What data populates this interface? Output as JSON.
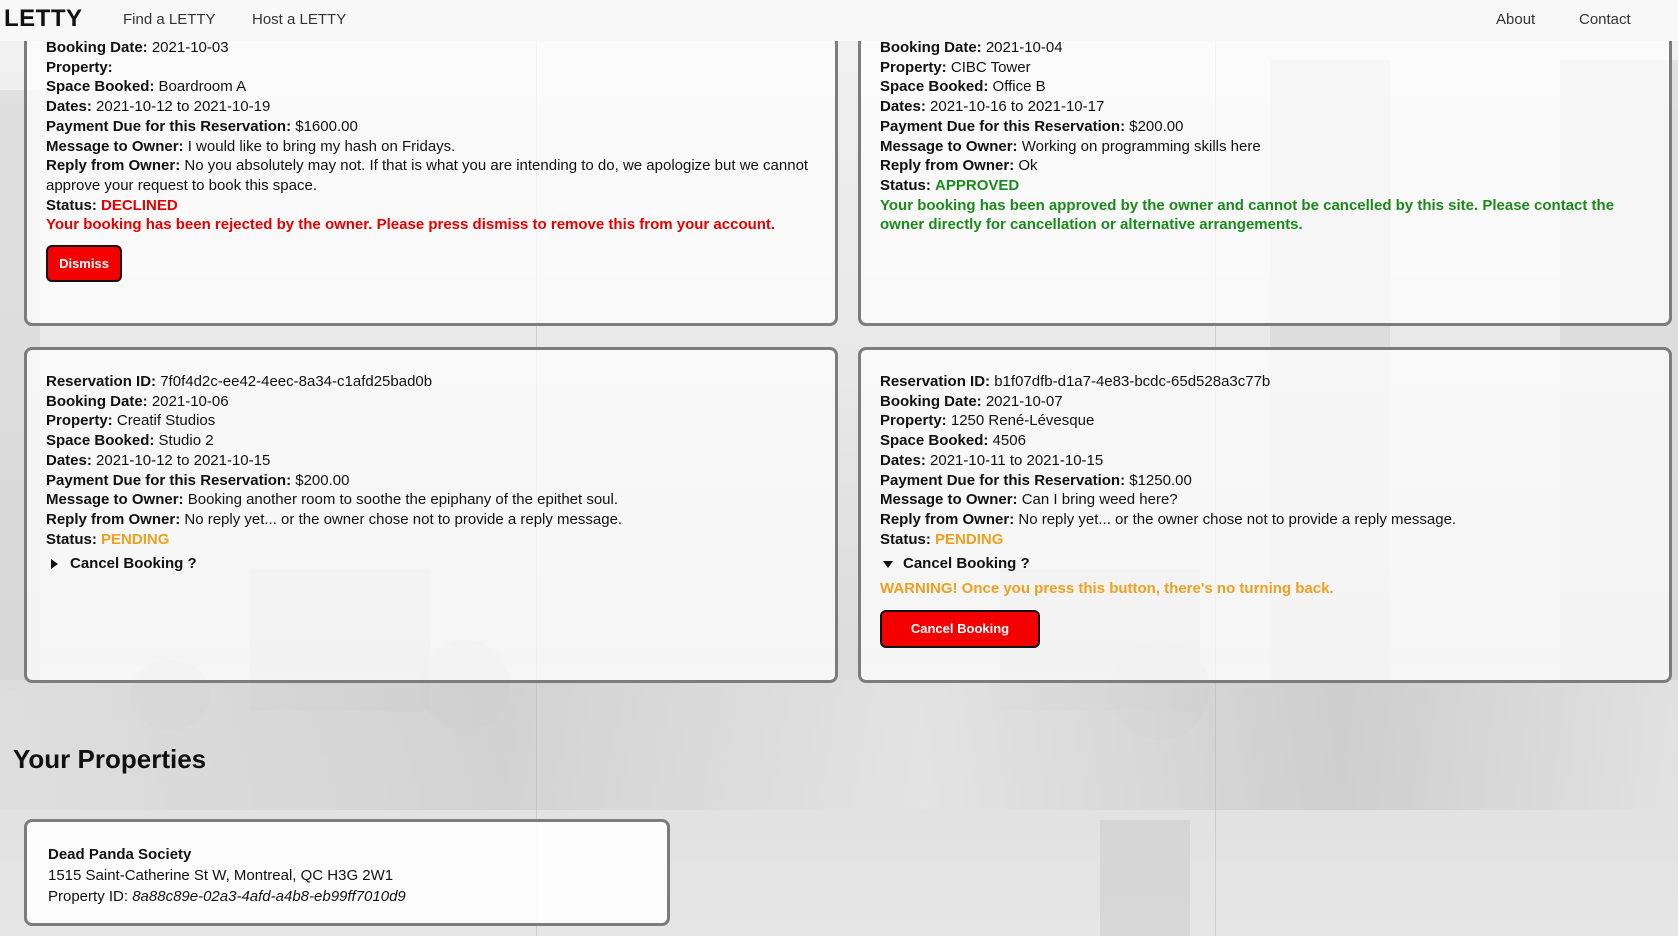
{
  "nav": {
    "brand": "LETTY",
    "links": [
      "Find a LETTY",
      "Host a LETTY"
    ],
    "right_links": [
      "About",
      "Contact"
    ]
  },
  "labels": {
    "reservation_id": "Reservation ID:",
    "booking_date": "Booking Date:",
    "property": "Property:",
    "space_booked": "Space Booked:",
    "dates": "Dates:",
    "payment": "Payment Due for this Reservation:",
    "message": "Message to Owner:",
    "reply": "Reply from Owner:",
    "status": "Status:"
  },
  "reservations": [
    {
      "booking_date": "2021-10-03",
      "property": "",
      "space": "Boardroom A",
      "dates": "2021-10-12 to 2021-10-19",
      "payment": "$1600.00",
      "message": "I would like to bring my hash on Fridays.",
      "reply": "No you absolutely may not. If that is what you are intending to do, we apologize but we cannot approve your request to book this space.",
      "status": "DECLINED",
      "notice": "Your booking has been rejected by the owner. Please press dismiss to remove this from your account.",
      "button": "Dismiss"
    },
    {
      "booking_date": "2021-10-04",
      "property": "CIBC Tower",
      "space": "Office B",
      "dates": "2021-10-16 to 2021-10-17",
      "payment": "$200.00",
      "message": "Working on programming skills here",
      "reply": "Ok",
      "status": "APPROVED",
      "notice": "Your booking has been approved by the owner and cannot be cancelled by this site. Please contact the owner directly for cancellation or alternative arrangements."
    },
    {
      "reservation_id": "7f0f4d2c-ee42-4eec-8a34-c1afd25bad0b",
      "booking_date": "2021-10-06",
      "property": "Creatif Studios",
      "space": "Studio 2",
      "dates": "2021-10-12 to 2021-10-15",
      "payment": "$200.00",
      "message": "Booking another room to soothe the epiphany of the epithet soul.",
      "reply": "No reply yet... or the owner chose not to provide a reply message.",
      "status": "PENDING",
      "cancel_summary": "Cancel Booking ?"
    },
    {
      "reservation_id": "b1f07dfb-d1a7-4e83-bcdc-65d528a3c77b",
      "booking_date": "2021-10-07",
      "property": "1250 René-Lévesque",
      "space": "4506",
      "dates": "2021-10-11 to 2021-10-15",
      "payment": "$1250.00",
      "message": "Can I bring weed here?",
      "reply": "No reply yet... or the owner chose not to provide a reply message.",
      "status": "PENDING",
      "cancel_summary": "Cancel Booking ?",
      "warning": "WARNING! Once you press this button, there's no turning back.",
      "button": "Cancel Booking"
    }
  ],
  "properties_section": {
    "title": "Your Properties",
    "items": [
      {
        "name": "Dead Panda Society",
        "address": "1515 Saint-Catherine St W, Montreal, QC H3G 2W1",
        "id_label": "Property ID:",
        "id": "8a88c89e-02a3-4afd-a4b8-eb99ff7010d9"
      }
    ]
  },
  "colors": {
    "declined": "#e60000",
    "approved": "#1a8a1a",
    "pending": "#f0a020",
    "danger_button": "#f40000"
  }
}
